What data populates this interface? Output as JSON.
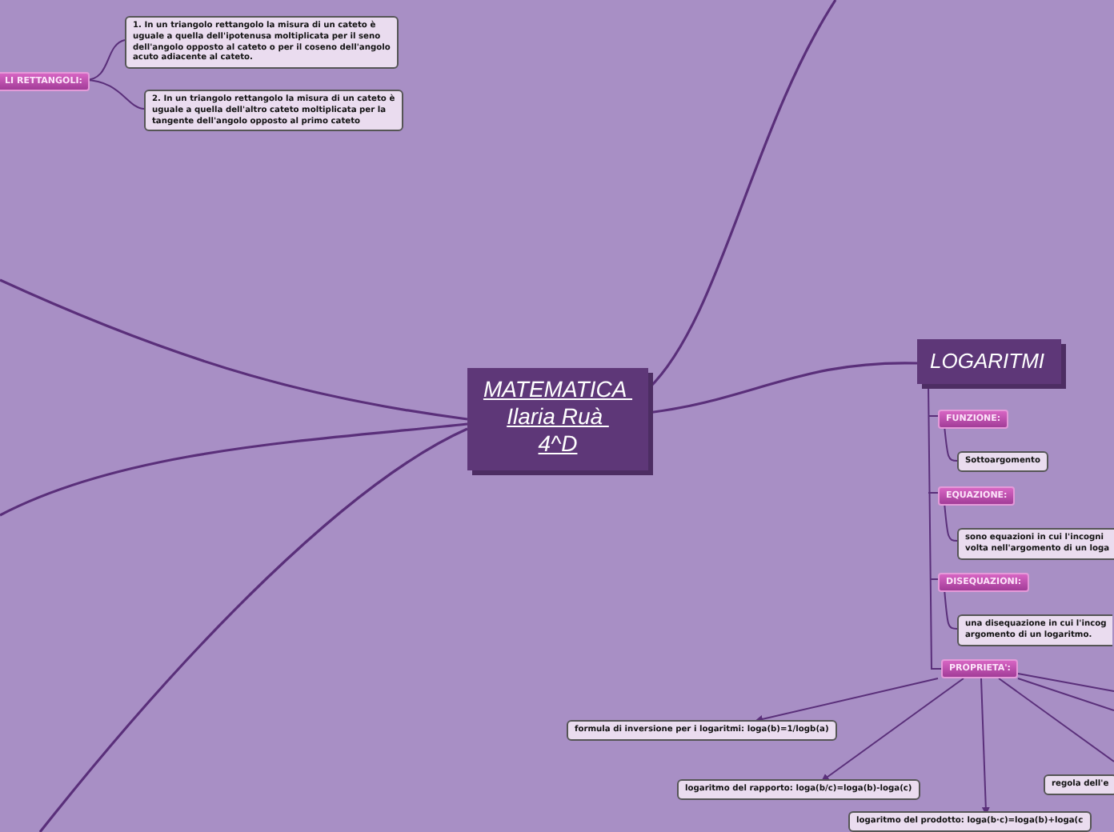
{
  "central": {
    "lines": [
      "MATEMATICA ",
      "Ilaria Ruà ",
      "4^D"
    ]
  },
  "branches": [
    {
      "kind": "category",
      "label": "LI RETTANGOLI:",
      "children": [
        {
          "kind": "note",
          "lines": [
            "1. In un triangolo rettangolo la misura di un cateto è",
            "uguale a quella dell'ipotenusa moltiplicata per il seno",
            "dell'angolo opposto al cateto o per il coseno dell'angolo",
            "acuto adiacente al cateto."
          ]
        },
        {
          "kind": "note",
          "lines": [
            "2. In un triangolo rettangolo la misura di un cateto è",
            "uguale a quella dell'altro cateto moltiplicata per la",
            "tangente dell'angolo opposto al primo cateto"
          ]
        }
      ]
    },
    {
      "kind": "topic",
      "label": "LOGARITMI",
      "children": [
        {
          "kind": "category",
          "label": "FUNZIONE:",
          "children": [
            {
              "kind": "note",
              "lines": [
                "Sottoargomento"
              ]
            }
          ]
        },
        {
          "kind": "category",
          "label": "EQUAZIONE:",
          "children": [
            {
              "kind": "note",
              "lines": [
                "sono equazioni in cui l'incogni",
                "volta nell'argomento di un loga"
              ]
            }
          ]
        },
        {
          "kind": "category",
          "label": "DISEQUAZIONI:",
          "children": [
            {
              "kind": "note",
              "lines": [
                "una disequazione in cui l'incog",
                "argomento di un logaritmo."
              ]
            }
          ]
        },
        {
          "kind": "category",
          "label": "PROPRIETA':",
          "children": [
            {
              "kind": "note",
              "lines": [
                "formula di inversione per i logaritmi: loga(b)=1/logb(a)"
              ]
            },
            {
              "kind": "note",
              "lines": [
                "logaritmo del rapporto: loga(b/c)=loga(b)-loga(c)"
              ]
            },
            {
              "kind": "note",
              "lines": [
                "regola dell'e"
              ]
            },
            {
              "kind": "note",
              "lines": [
                "logaritmo del prodotto: loga(b·c)=loga(b)+loga(c"
              ]
            }
          ]
        }
      ]
    }
  ]
}
